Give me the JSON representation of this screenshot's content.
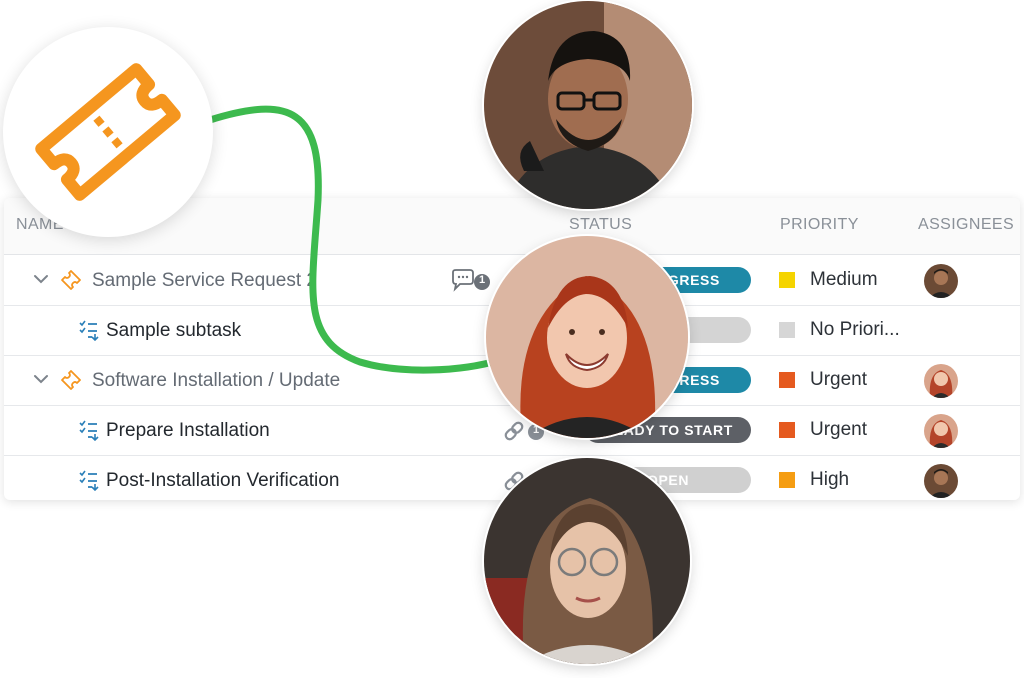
{
  "table": {
    "columns": {
      "name": "NAME",
      "status": "STATUS",
      "priority": "PRIORITY",
      "assignees": "ASSIGNEES"
    },
    "rows": [
      {
        "level": "parent",
        "name": "Sample Service Request 2",
        "meta_icon": "comment-icon",
        "meta_count": "1",
        "status": "IN PROGRESS",
        "status_color": "#1e89a7",
        "priority": "Medium",
        "priority_color": "#f5d400",
        "assignee": "man"
      },
      {
        "level": "child",
        "name": "Sample subtask",
        "meta_icon": "",
        "meta_count": "",
        "status": "",
        "status_color": "#d4d4d4",
        "priority": "No Priori...",
        "priority_color": "#d6d6d6",
        "assignee": ""
      },
      {
        "level": "parent",
        "name": "Software Installation / Update",
        "meta_icon": "",
        "meta_count": "",
        "status": "IN PROGRESS",
        "status_color": "#1e89a7",
        "priority": "Urgent",
        "priority_color": "#e55a1f",
        "assignee": "woman-red"
      },
      {
        "level": "child",
        "name": "Prepare Installation",
        "meta_icon": "link-icon",
        "meta_count": "1",
        "status": "READY TO START",
        "status_color": "#5d6066",
        "priority": "Urgent",
        "priority_color": "#e55a1f",
        "assignee": "woman-red"
      },
      {
        "level": "child",
        "name": "Post-Installation Verification",
        "meta_icon": "link-icon",
        "meta_count": "",
        "status": "OPEN",
        "status_color": "#d0d0d0",
        "priority": "High",
        "priority_color": "#f59d12",
        "assignee": "man"
      }
    ]
  },
  "colors": {
    "ticket_orange": "#f5961f",
    "connector_green": "#3dba4e",
    "subtask_blue": "#2a7fb8"
  },
  "decor": {
    "logo_icon": "ticket-icon",
    "portraits": [
      "man-glasses-headphones",
      "woman-red-hair-smiling",
      "woman-glasses-long-hair"
    ]
  }
}
